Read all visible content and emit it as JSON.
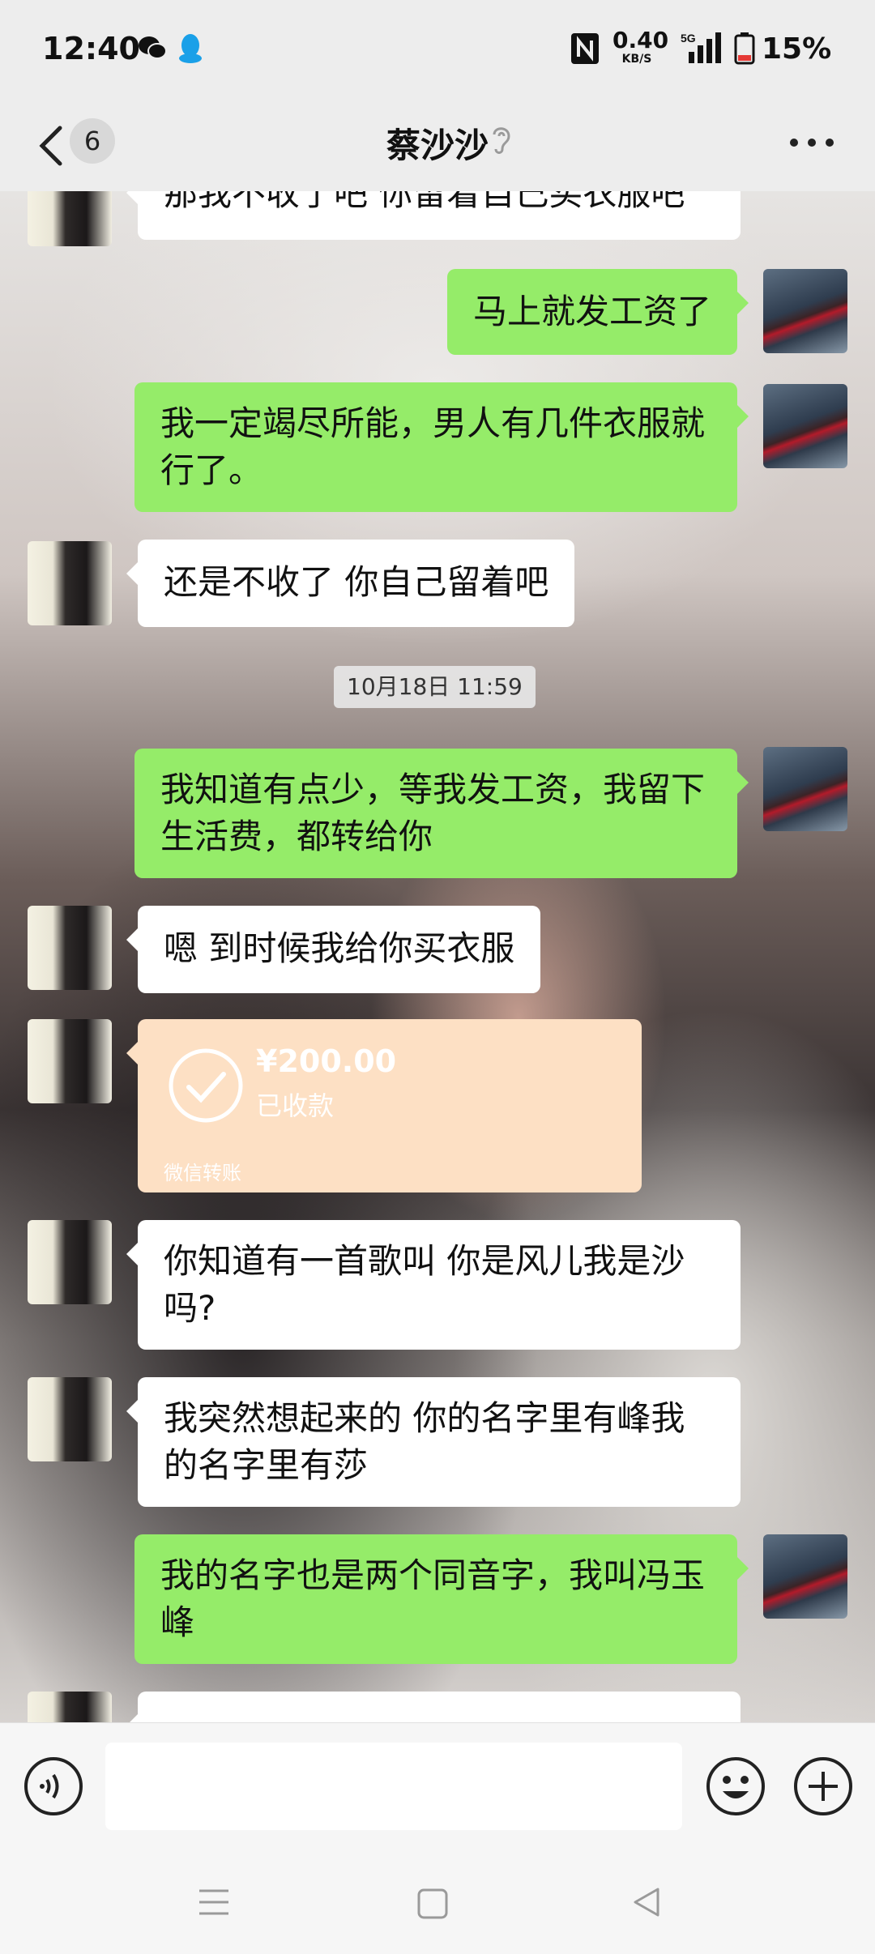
{
  "status_bar": {
    "time": "12:40",
    "network_speed": "0.40",
    "network_unit": "KB/S",
    "network_type": "5G",
    "battery": "15%"
  },
  "header": {
    "back_count": "6",
    "title": "蔡沙沙"
  },
  "messages": [
    {
      "side": "left",
      "text": "那我不收了吧 你留着自己买衣服吧"
    },
    {
      "side": "right",
      "text": "马上就发工资了"
    },
    {
      "side": "right",
      "text": "我一定竭尽所能，男人有几件衣服就行了。"
    },
    {
      "side": "left",
      "text": "还是不收了 你自己留着吧"
    },
    {
      "type": "timestamp",
      "text": "10月18日 11:59"
    },
    {
      "side": "right",
      "text": "我知道有点少，等我发工资，我留下生活费，都转给你"
    },
    {
      "side": "left",
      "text": "嗯 到时候我给你买衣服"
    },
    {
      "side": "left",
      "type": "transfer",
      "amount": "¥200.00",
      "status": "已收款",
      "source": "微信转账"
    },
    {
      "side": "left",
      "text": "你知道有一首歌叫 你是风儿我是沙吗?"
    },
    {
      "side": "left",
      "text": "我突然想起来的 你的名字里有峰我的名字里有莎"
    },
    {
      "side": "right",
      "text": "我的名字也是两个同音字，我叫冯玉峰"
    }
  ],
  "icons": {
    "back": "chevron-left-icon",
    "ear": "ear-icon",
    "more": "more-icon",
    "voice": "voice-icon",
    "emoji": "emoji-icon",
    "plus": "plus-icon"
  },
  "colors": {
    "sent_bubble": "#95ec69",
    "received_bubble": "#ffffff",
    "transfer_card": "#fde0c4"
  }
}
